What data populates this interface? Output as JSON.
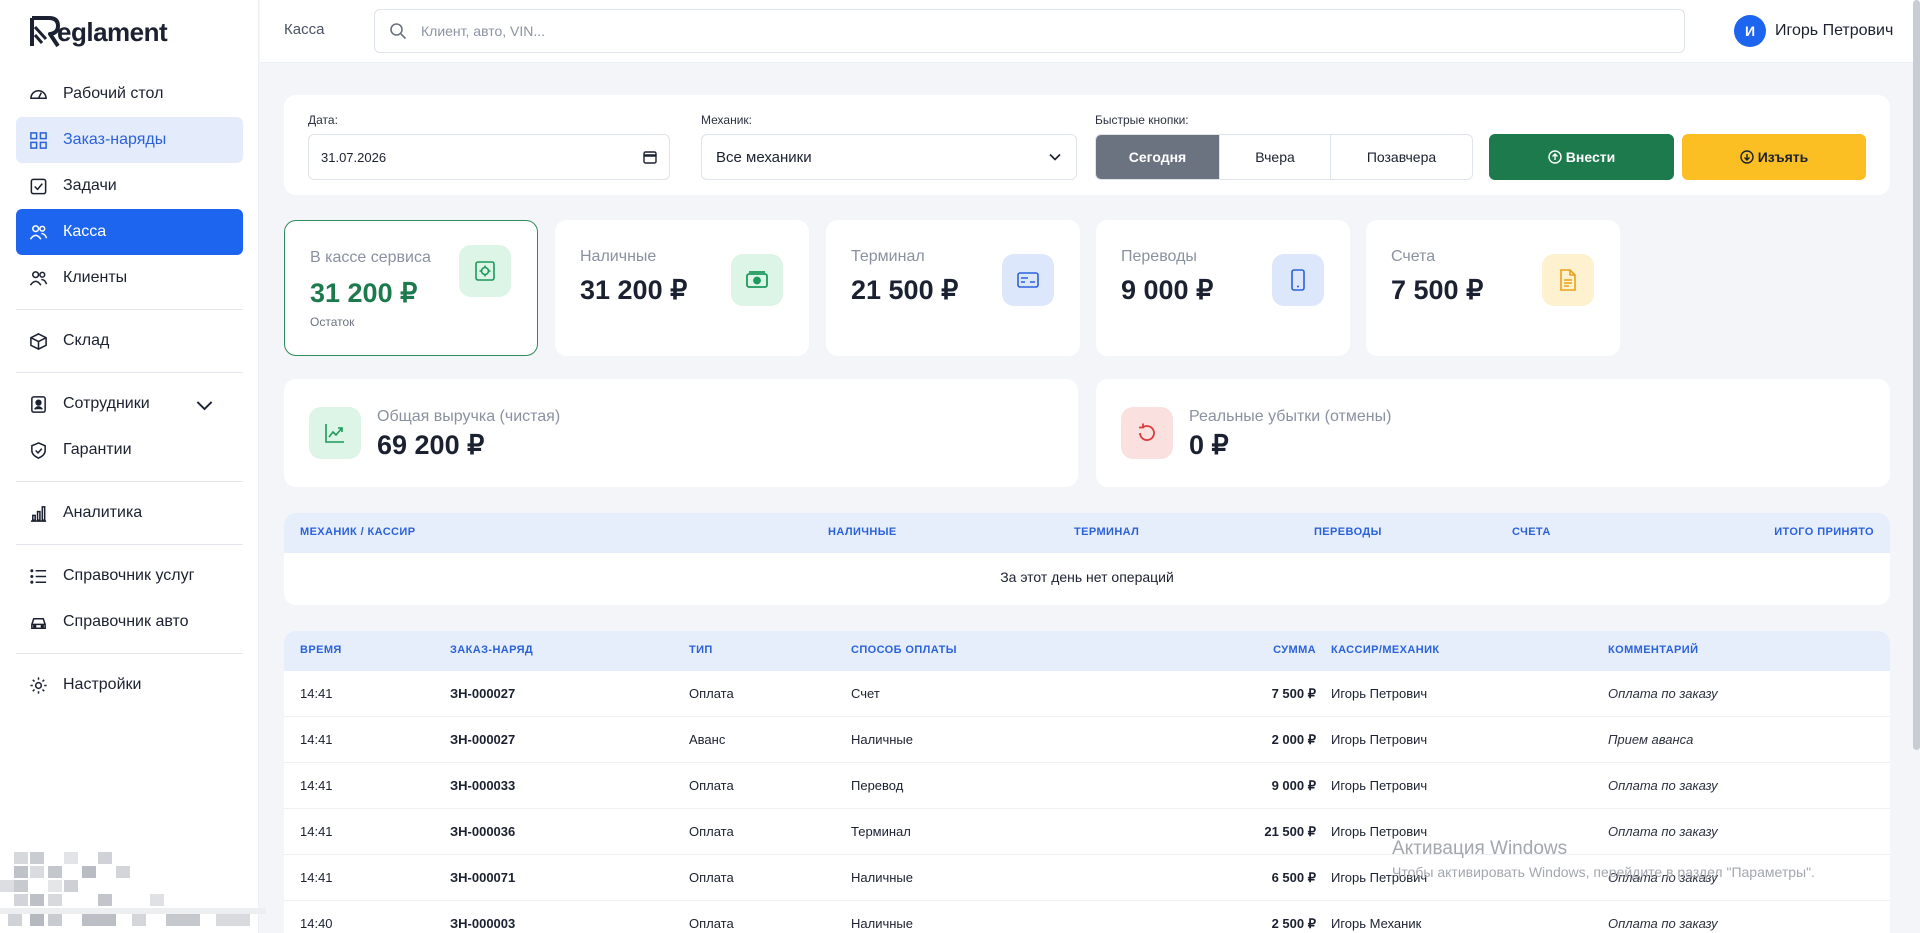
{
  "app": {
    "logo_text": "eglament",
    "logo_letter": "R"
  },
  "sidebar": {
    "items": [
      {
        "label": "Рабочий стол",
        "icon": "dashboard-icon"
      },
      {
        "label": "Заказ-наряды",
        "icon": "grid-icon"
      },
      {
        "label": "Задачи",
        "icon": "tasks-icon"
      },
      {
        "label": "Касса",
        "icon": "users-icon"
      },
      {
        "label": "Клиенты",
        "icon": "clients-icon"
      },
      {
        "label": "Склад",
        "icon": "box-icon"
      },
      {
        "label": "Сотрудники",
        "icon": "badge-icon"
      },
      {
        "label": "Гарантии",
        "icon": "shield-icon"
      },
      {
        "label": "Аналитика",
        "icon": "chart-icon"
      },
      {
        "label": "Справочник услуг",
        "icon": "list-icon"
      },
      {
        "label": "Справочник авто",
        "icon": "car-icon"
      },
      {
        "label": "Настройки",
        "icon": "gear-icon"
      }
    ]
  },
  "header": {
    "page": "Касса",
    "search_placeholder": "Клиент, авто, VIN...",
    "user_initial": "И",
    "user_name": "Игорь Петрович"
  },
  "filters": {
    "date_label": "Дата:",
    "date_value": "31.07.2026",
    "mechanic_label": "Механик:",
    "mechanic_value": "Все механики",
    "quick_label": "Быстрые кнопки:",
    "quick": [
      "Сегодня",
      "Вчера",
      "Позавчера"
    ],
    "deposit_label": "Внести",
    "withdraw_label": "Изъять"
  },
  "stats": {
    "balance": {
      "title": "В кассе сервиса",
      "value": "31 200 ₽",
      "sub": "Остаток"
    },
    "cash": {
      "title": "Наличные",
      "value": "31 200 ₽"
    },
    "terminal": {
      "title": "Терминал",
      "value": "21 500 ₽"
    },
    "transfers": {
      "title": "Переводы",
      "value": "9 000 ₽"
    },
    "invoices": {
      "title": "Счета",
      "value": "7 500 ₽"
    },
    "revenue": {
      "title": "Общая выручка (чистая)",
      "value": "69 200 ₽"
    },
    "losses": {
      "title": "Реальные убытки (отмены)",
      "value": "0 ₽"
    }
  },
  "summary_table": {
    "headers": [
      "МЕХАНИК / КАССИР",
      "НАЛИЧНЫЕ",
      "ТЕРМИНАЛ",
      "ПЕРЕВОДЫ",
      "СЧЕТА",
      "ИТОГО ПРИНЯТО"
    ],
    "empty": "За этот день нет операций"
  },
  "ops_table": {
    "headers": [
      "ВРЕМЯ",
      "ЗАКАЗ-НАРЯД",
      "ТИП",
      "СПОСОБ ОПЛАТЫ",
      "СУММА",
      "КАССИР/МЕХАНИК",
      "КОММЕНТАРИЙ"
    ],
    "rows": [
      [
        "14:41",
        "ЗН-000027",
        "Оплата",
        "Счет",
        "7 500 ₽",
        "Игорь Петрович",
        "Оплата по заказу"
      ],
      [
        "14:41",
        "ЗН-000027",
        "Аванс",
        "Наличные",
        "2 000 ₽",
        "Игорь Петрович",
        "Прием аванса"
      ],
      [
        "14:41",
        "ЗН-000033",
        "Оплата",
        "Перевод",
        "9 000 ₽",
        "Игорь Петрович",
        "Оплата по заказу"
      ],
      [
        "14:41",
        "ЗН-000036",
        "Оплата",
        "Терминал",
        "21 500 ₽",
        "Игорь Петрович",
        "Оплата по заказу"
      ],
      [
        "14:41",
        "ЗН-000071",
        "Оплата",
        "Наличные",
        "6 500 ₽",
        "Игорь Петрович",
        "Оплата по заказу"
      ],
      [
        "14:40",
        "ЗН-000003",
        "Оплата",
        "Наличные",
        "2 500 ₽",
        "Игорь Механик",
        "Оплата по заказу"
      ]
    ]
  },
  "watermark": {
    "title": "Активация Windows",
    "text": "Чтобы активировать Windows, перейдите в раздел \"Параметры\"."
  },
  "colors": {
    "accent": "#1d64ee",
    "green": "#1d7a4c",
    "yellow": "#fbbf24"
  }
}
